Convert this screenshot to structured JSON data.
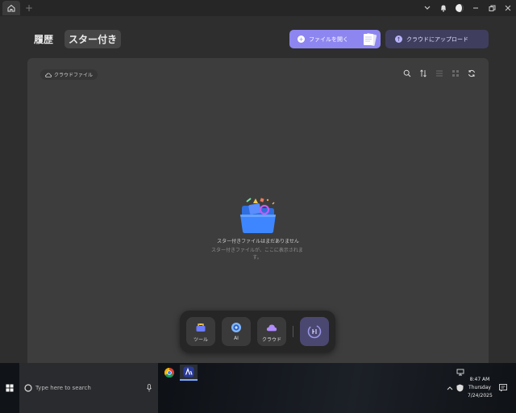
{
  "header": {
    "tab_history": "履歴",
    "tab_starred": "スター付き",
    "open_file_label": "ファイルを開く",
    "upload_cloud_label": "クラウドにアップロード"
  },
  "panel": {
    "cloud_chip_label": "クラウドファイル",
    "empty_title": "スター付きファイルはまだありません",
    "empty_subtitle": "スター付きファイルが、ここに表示されます。"
  },
  "dock": {
    "tools_label": "ツール",
    "ai_label": "AI",
    "cloud_label": "クラウド"
  },
  "taskbar": {
    "search_placeholder": "Type here to search",
    "time": "8:47 AM",
    "day": "Thursday",
    "date": "7/24/2025"
  },
  "colors": {
    "accent_primary": "#8e86f0",
    "accent_secondary": "#3f3e5e",
    "panel_bg": "#3d3d3d",
    "app_bg": "#2e2e2e"
  },
  "icons": [
    "home-icon",
    "plus-icon",
    "chevron-down-icon",
    "bell-icon",
    "theme-icon",
    "minimize-icon",
    "restore-icon",
    "close-icon",
    "plus-circle-icon",
    "upload-icon",
    "cloud-icon",
    "search-icon",
    "sort-icon",
    "list-view-icon",
    "grid-view-icon",
    "refresh-icon",
    "folder-icon",
    "toolbox-icon",
    "ai-icon",
    "windows-icon",
    "mic-icon",
    "chrome-icon",
    "app-icon",
    "notification-icon"
  ]
}
